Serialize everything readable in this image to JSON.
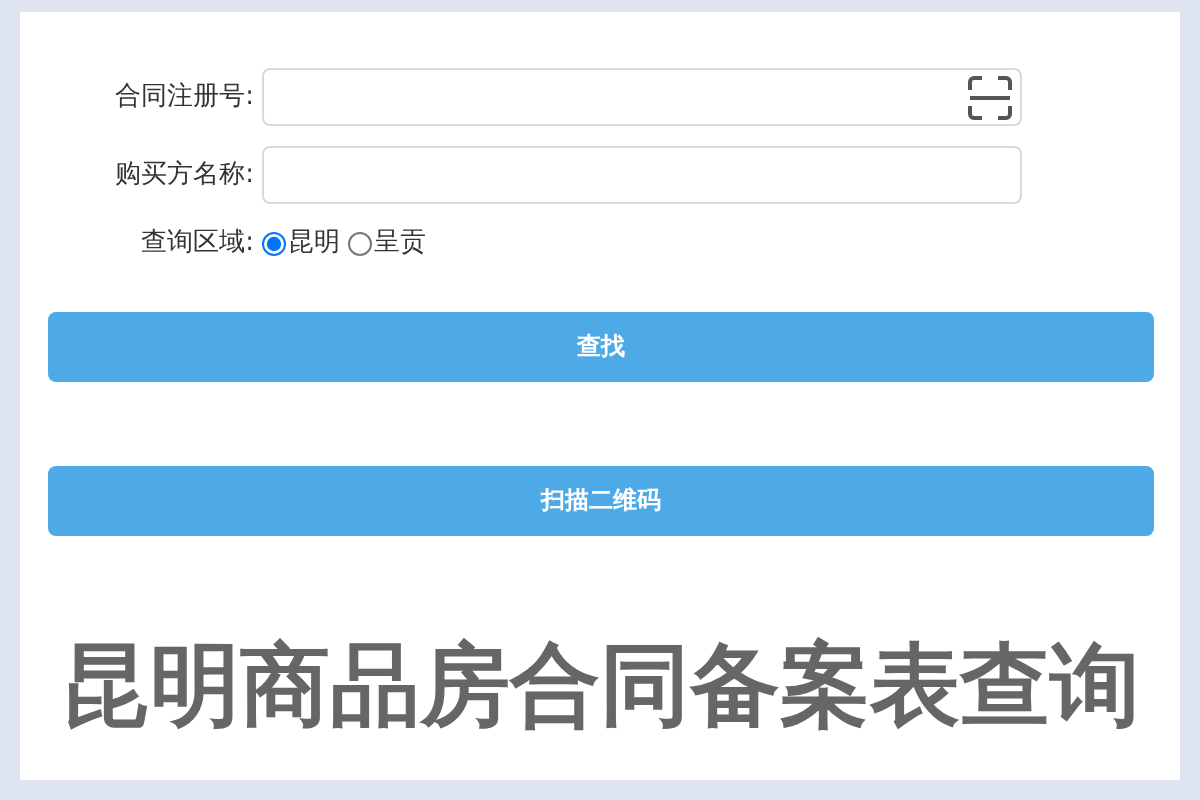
{
  "form": {
    "fields": [
      {
        "label": "合同注册号:",
        "kind": "scan"
      },
      {
        "label": "购买方名称:",
        "kind": "text"
      }
    ],
    "region": {
      "label": "查询区域:",
      "options": [
        {
          "label": "昆明",
          "selected": true
        },
        {
          "label": "呈贡",
          "selected": false
        }
      ]
    },
    "buttons": [
      "查找",
      "扫描二维码"
    ]
  },
  "title": "昆明商品房合同备案表查询"
}
